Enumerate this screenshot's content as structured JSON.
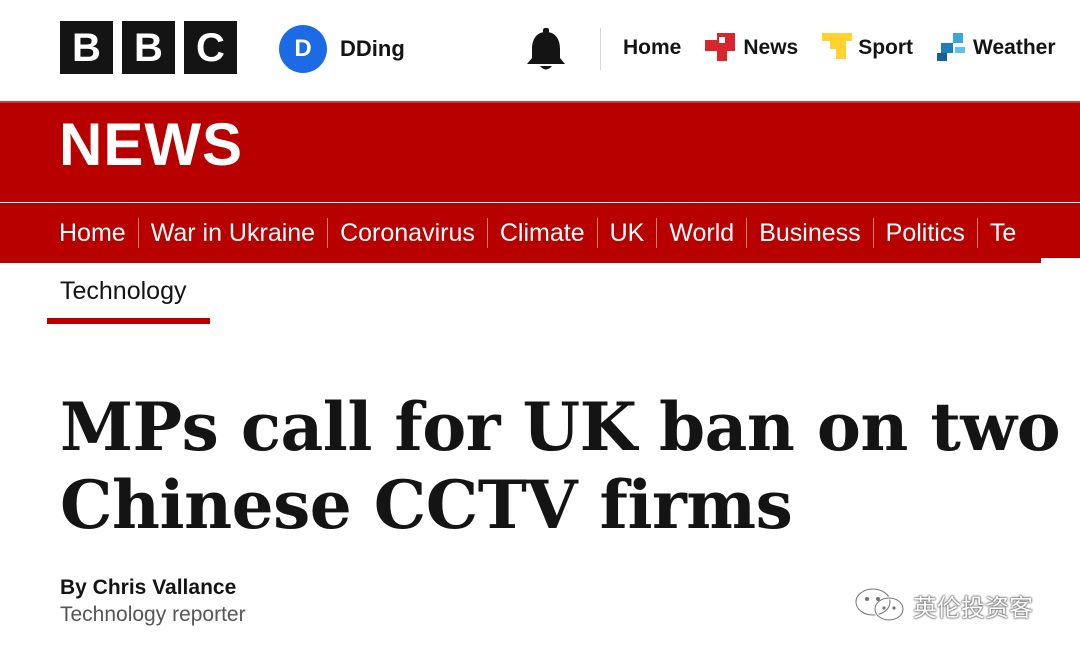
{
  "topbar": {
    "logo_letters": [
      "B",
      "B",
      "C"
    ],
    "account": {
      "initial": "D",
      "name": "DDing"
    },
    "nav": [
      {
        "label": "Home",
        "icon": ""
      },
      {
        "label": "News",
        "icon": "news-icon"
      },
      {
        "label": "Sport",
        "icon": "sport-icon"
      },
      {
        "label": "Weather",
        "icon": "weather-icon"
      }
    ]
  },
  "banner": {
    "title": "NEWS"
  },
  "sections": [
    "Home",
    "War in Ukraine",
    "Coronavirus",
    "Climate",
    "UK",
    "World",
    "Business",
    "Politics",
    "Te"
  ],
  "subnav": {
    "active": "Technology"
  },
  "article": {
    "headline": "MPs call for UK ban on two Chinese CCTV firms",
    "byline": "By Chris Vallance",
    "role": "Technology reporter"
  },
  "watermark": {
    "text": "英伦投资客"
  },
  "colors": {
    "brand_red": "#b80000",
    "avatar_blue": "#1d6ae5",
    "text": "#141414"
  }
}
